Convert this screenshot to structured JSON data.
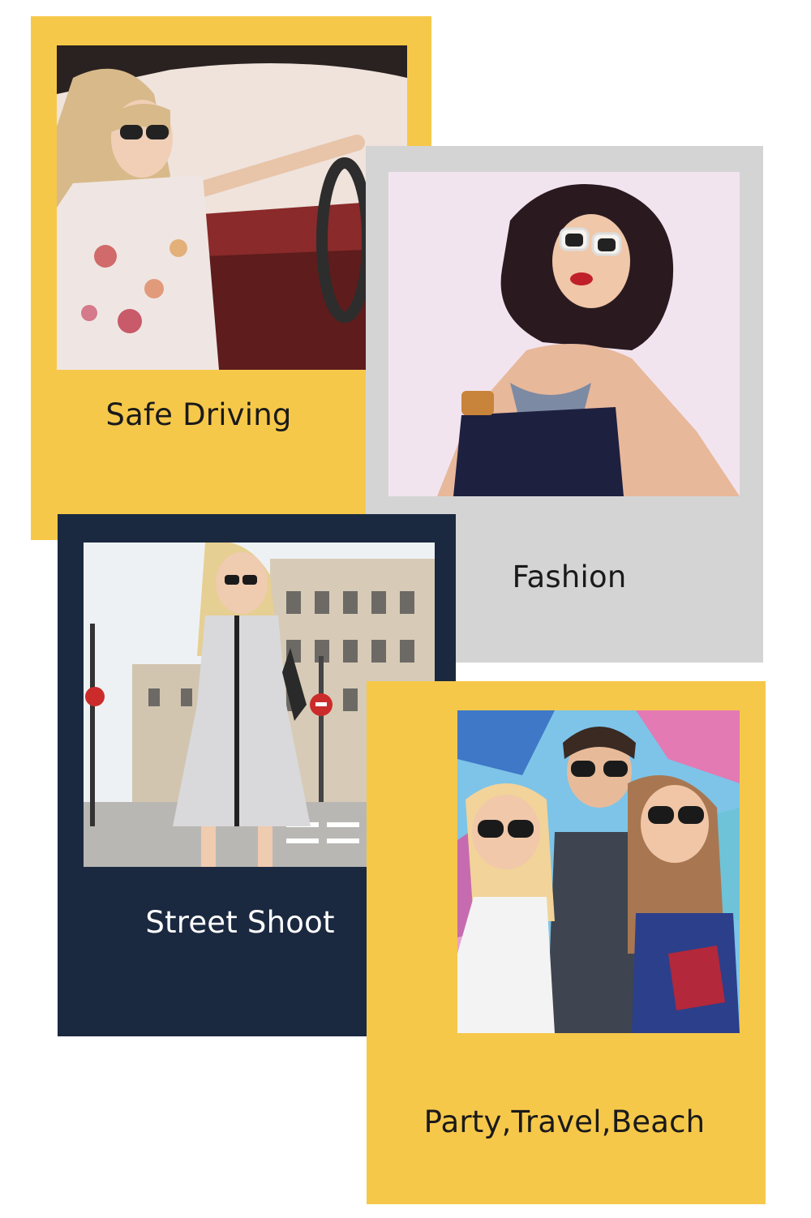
{
  "colors": {
    "yellow": "#f6c84a",
    "gray": "#d4d4d4",
    "navy": "#1b2940",
    "dark_text": "#1a1a1a",
    "light_text": "#ffffff"
  },
  "cards": [
    {
      "label": "Safe Driving",
      "theme": "yellow"
    },
    {
      "label": "Fashion",
      "theme": "gray"
    },
    {
      "label": "Street Shoot",
      "theme": "navy"
    },
    {
      "label": "Party,Travel,Beach",
      "theme": "yellow"
    }
  ]
}
